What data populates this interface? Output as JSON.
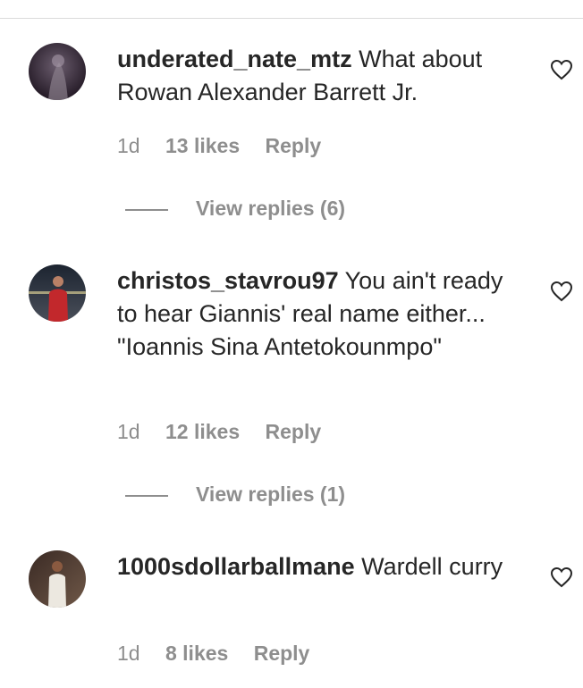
{
  "comments": [
    {
      "username": "underated_nate_mtz",
      "text": "What about Rowan Alexander Barrett Jr.",
      "time": "1d",
      "likes": "13 likes",
      "reply": "Reply",
      "view_replies": "View replies (6)",
      "like_icon": "heart-outline-icon"
    },
    {
      "username": "christos_stavrou97",
      "text": "You ain't ready to hear Giannis' real name either... \"Ioannis Sina Antetokounmpo\"",
      "time": "1d",
      "likes": "12 likes",
      "reply": "Reply",
      "view_replies": "View replies (1)",
      "like_icon": "heart-outline-icon"
    },
    {
      "username": "1000sdollarballmane",
      "text": "Wardell curry",
      "time": "1d",
      "likes": "8 likes",
      "reply": "Reply",
      "like_icon": "heart-outline-icon"
    }
  ]
}
